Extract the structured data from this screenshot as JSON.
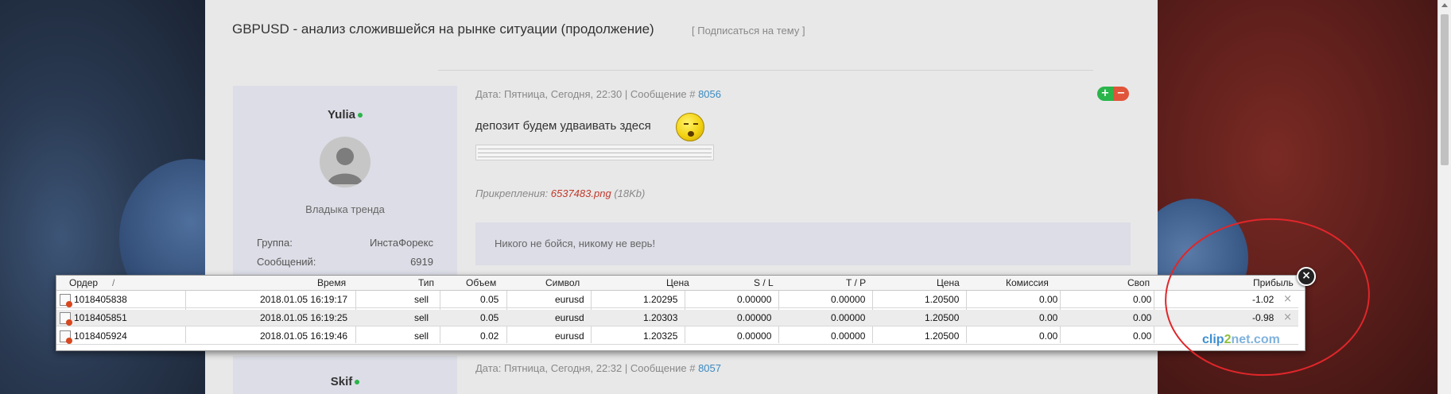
{
  "topic": {
    "title": "GBPUSD - анализ сложившейся на рынке ситуации (продолжение)",
    "subscribe_label": "[ Подписаться на тему ]"
  },
  "post1": {
    "user": {
      "name": "Yulia",
      "rank": "Владыка тренда",
      "group_label": "Группа:",
      "group_value": "ИнстаФорекс",
      "messages_label": "Сообщений:",
      "messages_value": "6919"
    },
    "meta_prefix": "Дата: Пятница, Сегодня, 22:30 | Сообщение #",
    "meta_number": "8056",
    "vote_plus": "+",
    "vote_minus": "−",
    "text": "депозит будем удваивать здеся",
    "attachments_label": "Прикрепления:",
    "attachment_file": "6537483.png",
    "attachment_size": "(18Kb)",
    "signature": "Никого не бойся, никому не верь!"
  },
  "post2": {
    "user": {
      "name": "Skif"
    },
    "meta_prefix": "Дата: Пятница, Сегодня, 22:32 | Сообщение #",
    "meta_number": "8057"
  },
  "trade_table": {
    "columns": [
      "Ордер",
      "/",
      "Время",
      "Тип",
      "Объем",
      "Символ",
      "Цена",
      "S / L",
      "T / P",
      "Цена",
      "Комиссия",
      "Своп",
      "Прибыль"
    ],
    "rows": [
      {
        "order": "1018405838",
        "time": "2018.01.05 16:19:17",
        "type": "sell",
        "volume": "0.05",
        "symbol": "eurusd",
        "price": "1.20295",
        "sl": "0.00000",
        "tp": "0.00000",
        "cur_price": "1.20500",
        "commission": "0.00",
        "swap": "0.00",
        "profit": "-1.02",
        "close": "×"
      },
      {
        "order": "1018405851",
        "time": "2018.01.05 16:19:25",
        "type": "sell",
        "volume": "0.05",
        "symbol": "eurusd",
        "price": "1.20303",
        "sl": "0.00000",
        "tp": "0.00000",
        "cur_price": "1.20500",
        "commission": "0.00",
        "swap": "0.00",
        "profit": "-0.98",
        "close": "×"
      },
      {
        "order": "1018405924",
        "time": "2018.01.05 16:19:46",
        "type": "sell",
        "volume": "0.02",
        "symbol": "eurusd",
        "price": "1.20325",
        "sl": "0.00000",
        "tp": "0.00000",
        "cur_price": "1.20500",
        "commission": "0.00",
        "swap": "0.00",
        "profit": "",
        "close": ""
      }
    ],
    "close_label": "×",
    "watermark": {
      "part1": "clip",
      "part2": "2",
      "part3": "net.com"
    }
  },
  "colors": {
    "accent_link": "#3a8ac2",
    "attachment": "#c0392b",
    "online": "#2ab54a",
    "annotation_circle": "#e0262a"
  }
}
